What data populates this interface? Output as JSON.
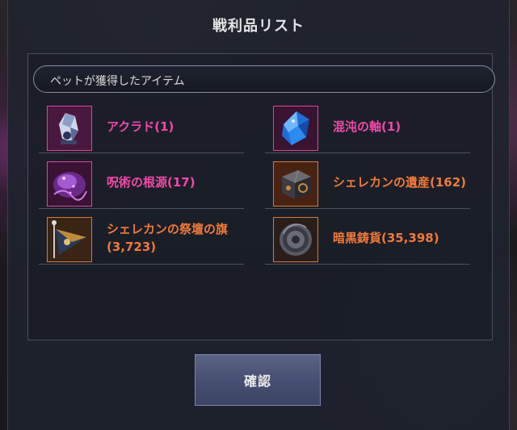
{
  "dialog": {
    "title": "戦利品リスト",
    "section_title": "ペットが獲得したアイテム",
    "confirm_label": "確認"
  },
  "items": [
    {
      "name": "アクラド(1)",
      "grade": "pink",
      "icon": "crystal-shard-icon"
    },
    {
      "name": "混沌の軸(1)",
      "grade": "pink",
      "icon": "blue-gem-icon"
    },
    {
      "name": "呪術の根源(17)",
      "grade": "pink",
      "icon": "purple-essence-icon"
    },
    {
      "name": "シェレカンの遺産(162)",
      "grade": "orange",
      "icon": "treasure-box-icon"
    },
    {
      "name": "シェレカンの祭壇の旗(3,723)",
      "grade": "orange",
      "icon": "banner-flag-icon"
    },
    {
      "name": "暗黒鋳貨(35,398)",
      "grade": "orange",
      "icon": "dark-coin-icon"
    }
  ]
}
